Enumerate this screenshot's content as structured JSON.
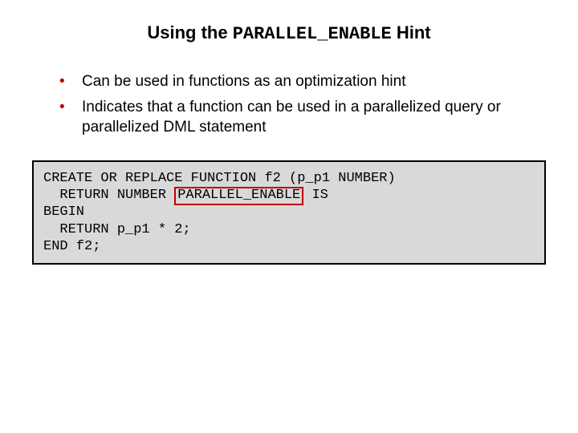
{
  "title": {
    "pre": "Using the ",
    "mono": "PARALLEL_ENABLE",
    "post": " Hint"
  },
  "bullets": [
    "Can be used in functions as an optimization hint",
    "Indicates that a function can be used in a parallelized query or parallelized DML statement"
  ],
  "code": {
    "line1": "CREATE OR REPLACE FUNCTION f2 (p_p1 NUMBER)",
    "line2_pre": "  RETURN NUMBER ",
    "line2_hl": "PARALLEL_ENABLE",
    "line2_post": " IS",
    "line3": "BEGIN",
    "line4": "  RETURN p_p1 * 2;",
    "line5": "END f2;"
  }
}
